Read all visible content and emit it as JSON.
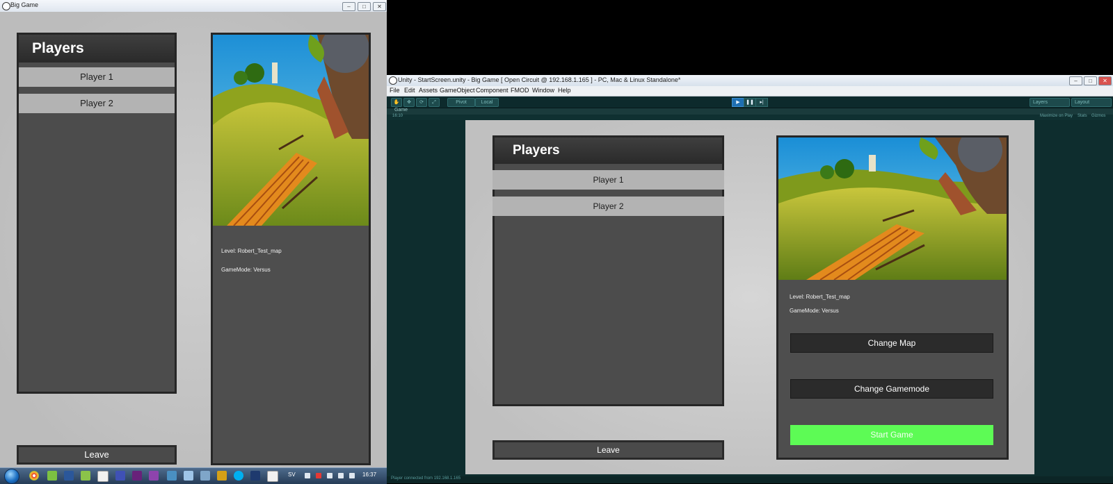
{
  "left_window": {
    "title": "Big Game",
    "players": {
      "header": "Players",
      "items": [
        "Player 1",
        "Player 2"
      ]
    },
    "level_info": {
      "level": "Level: Robert_Test_map",
      "gamemode": "GameMode: Versus"
    },
    "leave_label": "Leave"
  },
  "taskbar": {
    "language": "SV",
    "clock": "16:37"
  },
  "unity": {
    "title": "Unity - StartScreen.unity - Big Game [ Open Circuit @ 192.168.1.165 ] - PC, Mac & Linux Standalone*",
    "menu": [
      "File",
      "Edit",
      "Assets",
      "GameObject",
      "Component",
      "FMOD",
      "Window",
      "Help"
    ],
    "toolbar": {
      "pivot_label": "Pivot",
      "local_label": "Local",
      "layers_label": "Layers",
      "layout_label": "Layout"
    },
    "game_tab_label": "Game",
    "aspect": "16:10",
    "gamebar": {
      "maximize": "Maximize on Play",
      "stats": "Stats",
      "gizmos": "Gizmos"
    },
    "status": "Player  connected from 192.168.1.165",
    "game": {
      "players_header": "Players",
      "players": [
        "Player 1",
        "Player 2"
      ],
      "level": "Level: Robert_Test_map",
      "gamemode": "GameMode: Versus",
      "change_map_label": "Change Map",
      "change_gamemode_label": "Change Gamemode",
      "start_game_label": "Start Game",
      "leave_label": "Leave"
    }
  },
  "colors": {
    "start_button": "#5dfb55",
    "panel_dark": "#4c4c4c",
    "player_item": "#b3b3b3",
    "editor_bg": "#0f2d2d"
  }
}
